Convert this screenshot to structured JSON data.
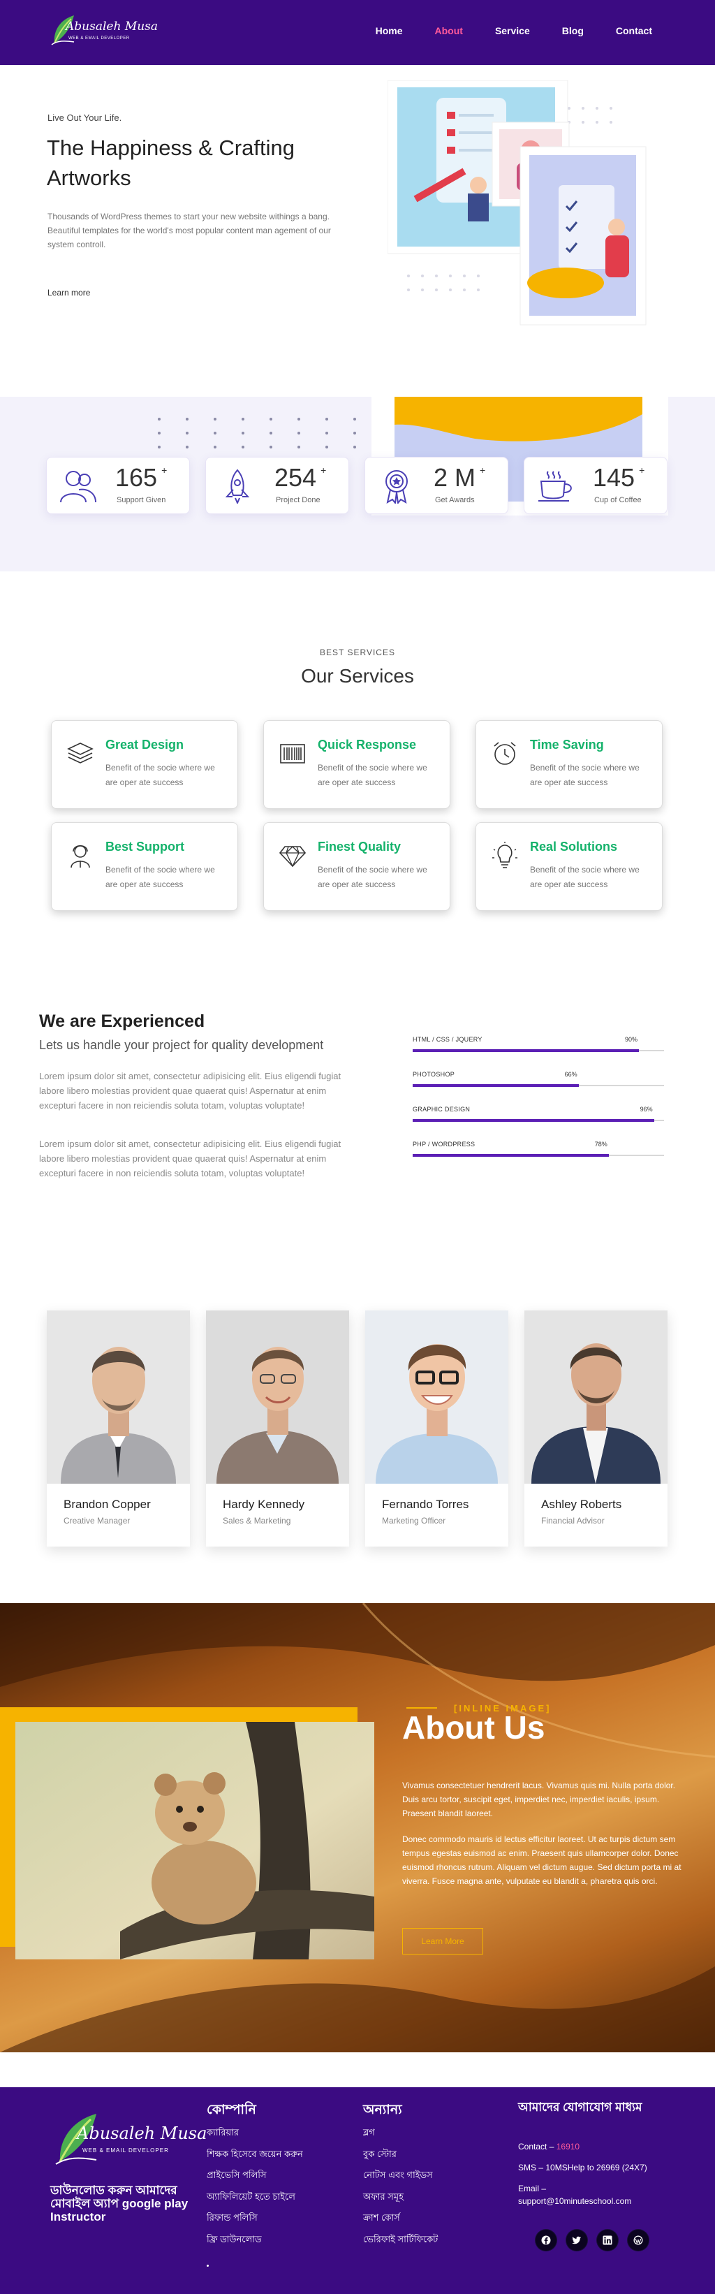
{
  "brand": {
    "name": "Abusaleh Musa",
    "tagline": "WEB & EMAIL DEVELOPER"
  },
  "nav": {
    "items": [
      {
        "label": "Home"
      },
      {
        "label": "About"
      },
      {
        "label": "Service"
      },
      {
        "label": "Blog"
      },
      {
        "label": "Contact"
      }
    ],
    "active": "About",
    "active_color": "#ff5a9a"
  },
  "hero": {
    "kicker": "Live Out Your Life.",
    "title": "The Happiness & Crafting Artworks",
    "description": "Thousands of WordPress themes to start your new website withings a bang. Beautiful templates for the world's most popular content man agement of our system controll.",
    "link": "Learn more"
  },
  "stats": [
    {
      "icon": "people-icon",
      "value": "165",
      "suffix": "+",
      "label": "Support Given"
    },
    {
      "icon": "rocket-icon",
      "value": "254",
      "suffix": "+",
      "label": "Project Done"
    },
    {
      "icon": "award-icon",
      "value": "2 M",
      "suffix": "+",
      "label": "Get Awards"
    },
    {
      "icon": "coffee-cup-icon",
      "value": "145",
      "suffix": "+",
      "label": "Cup of Coffee"
    }
  ],
  "services": {
    "kicker": "BEST SERVICES",
    "title": "Our Services",
    "items": [
      {
        "icon": "layers-icon",
        "title": "Great Design",
        "desc": "Benefit of the socie where we are oper ate success"
      },
      {
        "icon": "barcode-icon",
        "title": "Quick Response",
        "desc": "Benefit of the socie where we are oper ate success"
      },
      {
        "icon": "alarm-clock-icon",
        "title": "Time Saving",
        "desc": "Benefit of the socie where we are oper ate success"
      },
      {
        "icon": "support-agent-icon",
        "title": "Best Support",
        "desc": "Benefit of the socie where we are oper ate success"
      },
      {
        "icon": "diamond-icon",
        "title": "Finest Quality",
        "desc": "Benefit of the socie where we are oper ate success"
      },
      {
        "icon": "lightbulb-icon",
        "title": "Real Solutions",
        "desc": "Benefit of the socie where we are oper ate success"
      }
    ],
    "title_color": "#15b26b"
  },
  "experience": {
    "title": "We are Experienced",
    "subtitle": "Lets us handle your project for quality development",
    "paragraphs": [
      "Lorem ipsum dolor sit amet, consectetur adipisicing elit. Eius eligendi fugiat labore libero molestias provident quae quaerat quis! Aspernatur at enim excepturi facere in non reiciendis soluta totam, voluptas voluptate!",
      "Lorem ipsum dolor sit amet, consectetur adipisicing elit. Eius eligendi fugiat labore libero molestias provident quae quaerat quis! Aspernatur at enim excepturi facere in non reiciendis soluta totam, voluptas voluptate!"
    ],
    "skills": [
      {
        "name": "HTML / CSS / JQUERY",
        "percent": 90,
        "label": "90%"
      },
      {
        "name": "PHOTOSHOP",
        "percent": 66,
        "label": "66%"
      },
      {
        "name": "GRAPHIC DESIGN",
        "percent": 96,
        "label": "96%"
      },
      {
        "name": "PHP / WORDPRESS",
        "percent": 78,
        "label": "78%"
      }
    ],
    "bar_color": "#5b1fb5"
  },
  "team": [
    {
      "name": "Brandon Copper",
      "role": "Creative Manager"
    },
    {
      "name": "Hardy Kennedy",
      "role": "Sales & Marketing"
    },
    {
      "name": "Fernando Torres",
      "role": "Marketing Officer"
    },
    {
      "name": "Ashley Roberts",
      "role": "Financial Advisor"
    }
  ],
  "about": {
    "kicker": "[INLINE IMAGE]",
    "title": "About Us",
    "paragraphs": [
      "Vivamus consectetuer hendrerit lacus. Vivamus quis mi. Nulla porta dolor. Duis arcu tortor, suscipit eget, imperdiet nec, imperdiet iaculis, ipsum. Praesent blandit laoreet.",
      "Donec commodo mauris id lectus efficitur laoreet. Ut ac turpis dictum sem tempus egestas euismod ac enim. Praesent quis ullamcorper dolor. Donec euismod rhoncus rutrum. Aliquam vel dictum augue. Sed dictum porta mi at viverra. Fusce magna ante, vulputate eu blandit a, pharetra quis orci."
    ],
    "button": "Learn More",
    "accent": "#f6b300"
  },
  "footer": {
    "app_text": "ডাউনলোড করুন আমাদের মোবাইল অ্যাপ google play Instructor",
    "company": {
      "title": "কোম্পানি",
      "links": [
        "ক্যারিয়ার",
        "শিক্ষক হিসেবে জয়েন করুন",
        "প্রাইভেসি পলিসি",
        "অ্যাফিলিয়েট হতে চাইলে",
        "রিফান্ড পলিসি",
        "ফ্রি ডাউনলোড"
      ]
    },
    "others": {
      "title": "অন্যান্য",
      "links": [
        "ব্লগ",
        "বুক স্টোর",
        "নোটস এবং গাইডস",
        "অফার সমূহ",
        "ক্রাশ কোর্স",
        "ভেরিফাই সার্টিফিকেট"
      ]
    },
    "contact": {
      "title": "আমাদের যোগাযোগ মাধ্যম",
      "contact_label": "Contact –",
      "contact_number": "16910",
      "sms": "SMS – 10MSHelp to 26969 (24X7)",
      "email_label": "Email –",
      "email": "support@10minuteschool.com"
    },
    "socials": [
      {
        "icon": "facebook-icon"
      },
      {
        "icon": "twitter-icon"
      },
      {
        "icon": "linkedin-icon"
      },
      {
        "icon": "wordpress-icon"
      }
    ],
    "bg_color": "#3b0b82"
  }
}
